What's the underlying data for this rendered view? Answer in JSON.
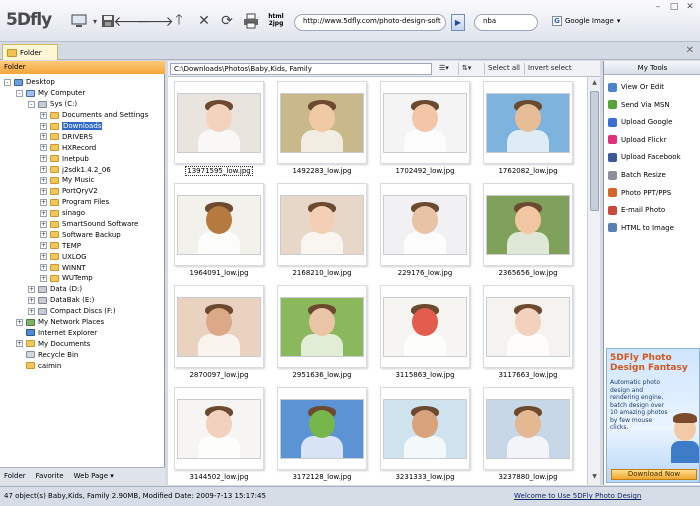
{
  "app": {
    "logo": "5Dfly"
  },
  "toolbar": {
    "html_label": "html 2jpg",
    "url": "http://www.5dfly.com/photo-design-soft",
    "search_text": "nba",
    "engine": "Google Image"
  },
  "tab": {
    "label": "Folder"
  },
  "left_panel": {
    "header": "Folder",
    "tree": [
      {
        "label": "Desktop",
        "level": 0,
        "exp": "-",
        "icon": "desk"
      },
      {
        "label": "My Computer",
        "level": 1,
        "exp": "-",
        "icon": "pc"
      },
      {
        "label": "Sys (C:)",
        "level": 2,
        "exp": "-",
        "icon": "drive"
      },
      {
        "label": "Documents and Settings",
        "level": 3,
        "exp": "+",
        "icon": "folder"
      },
      {
        "label": "Downloads",
        "level": 3,
        "exp": "+",
        "icon": "folder",
        "selected": true
      },
      {
        "label": "DRIVERS",
        "level": 3,
        "exp": "+",
        "icon": "folder"
      },
      {
        "label": "HXRecord",
        "level": 3,
        "exp": "+",
        "icon": "folder"
      },
      {
        "label": "Inetpub",
        "level": 3,
        "exp": "+",
        "icon": "folder"
      },
      {
        "label": "j2sdk1.4.2_06",
        "level": 3,
        "exp": "+",
        "icon": "folder"
      },
      {
        "label": "My Music",
        "level": 3,
        "exp": "+",
        "icon": "folder"
      },
      {
        "label": "PortQryV2",
        "level": 3,
        "exp": "+",
        "icon": "folder"
      },
      {
        "label": "Program Files",
        "level": 3,
        "exp": "+",
        "icon": "folder"
      },
      {
        "label": "sinago",
        "level": 3,
        "exp": "+",
        "icon": "folder"
      },
      {
        "label": "SmartSound Software",
        "level": 3,
        "exp": "+",
        "icon": "folder"
      },
      {
        "label": "Software Backup",
        "level": 3,
        "exp": "+",
        "icon": "folder"
      },
      {
        "label": "TEMP",
        "level": 3,
        "exp": "+",
        "icon": "folder"
      },
      {
        "label": "UXLOG",
        "level": 3,
        "exp": "+",
        "icon": "folder"
      },
      {
        "label": "WINNT",
        "level": 3,
        "exp": "+",
        "icon": "folder"
      },
      {
        "label": "WUTemp",
        "level": 3,
        "exp": "+",
        "icon": "folder"
      },
      {
        "label": "Data (D:)",
        "level": 2,
        "exp": "+",
        "icon": "drive"
      },
      {
        "label": "DataBak (E:)",
        "level": 2,
        "exp": "+",
        "icon": "drive"
      },
      {
        "label": "Compact Discs (F:)",
        "level": 2,
        "exp": "+",
        "icon": "drive"
      },
      {
        "label": "My Network Places",
        "level": 1,
        "exp": "+",
        "icon": "net"
      },
      {
        "label": "Internet Explorer",
        "level": 1,
        "exp": "",
        "icon": "ie"
      },
      {
        "label": "My Documents",
        "level": 1,
        "exp": "+",
        "icon": "folder"
      },
      {
        "label": "Recycle Bin",
        "level": 1,
        "exp": "",
        "icon": "bin"
      },
      {
        "label": "caimin",
        "level": 1,
        "exp": "",
        "icon": "folder"
      }
    ],
    "bottom_tabs": [
      "Folder",
      "Favorite",
      "Web Page ▾"
    ]
  },
  "center": {
    "path": "C:\\Downloads\\Photos\\Baby,Kids, Family",
    "sort_icon": "sort-icon",
    "select_all": "Select all",
    "invert_select": "Invert select",
    "thumbnails": [
      {
        "file": "13971595_low.jpg",
        "bg": "#e9e4de",
        "accent": "#f4d3bd",
        "selected": true
      },
      {
        "file": "1492283_low.jpg",
        "bg": "#c9b98a",
        "accent": "#f0c9a5"
      },
      {
        "file": "1702492_low.jpg",
        "bg": "#f4f4f4",
        "accent": "#f2c6a6"
      },
      {
        "file": "1762082_low.jpg",
        "bg": "#7db3dc",
        "accent": "#e7bd97"
      },
      {
        "file": "1964091_low.jpg",
        "bg": "#f3f1ec",
        "accent": "#b57a3f"
      },
      {
        "file": "2168210_low.jpg",
        "bg": "#e6d7c8",
        "accent": "#f2cfb5"
      },
      {
        "file": "229176_low.jpg",
        "bg": "#f1f1f3",
        "accent": "#e9c3a6"
      },
      {
        "file": "2365656_low.jpg",
        "bg": "#7fa15c",
        "accent": "#f0c7a2"
      },
      {
        "file": "2870097_low.jpg",
        "bg": "#e9d3c0",
        "accent": "#dba888"
      },
      {
        "file": "2951636_low.jpg",
        "bg": "#8cb85d",
        "accent": "#eac5a8"
      },
      {
        "file": "3115863_low.jpg",
        "bg": "#f7f5f2",
        "accent": "#e35c4e"
      },
      {
        "file": "3117663_low.jpg",
        "bg": "#f6f2ef",
        "accent": "#f3d1bd"
      },
      {
        "file": "3144502_low.jpg",
        "bg": "#f7f5f3",
        "accent": "#f2d2bf"
      },
      {
        "file": "3172128_low.jpg",
        "bg": "#5b93d4",
        "accent": "#77b64a"
      },
      {
        "file": "3231333_low.jpg",
        "bg": "#cfe3ee",
        "accent": "#d8a27c"
      },
      {
        "file": "3237880_low.jpg",
        "bg": "#c8d7e6",
        "accent": "#e4b893"
      }
    ]
  },
  "right_panel": {
    "header": "My Tools",
    "tools": [
      {
        "label": "View Or Edit",
        "icon": "view-icon",
        "color": "#4c84c9"
      },
      {
        "label": "Send Via MSN",
        "icon": "msn-icon",
        "color": "#57a23c"
      },
      {
        "label": "Upload Google",
        "icon": "google-icon",
        "color": "#3b6fd4"
      },
      {
        "label": "Upload Flickr",
        "icon": "flickr-icon",
        "color": "#e0307a"
      },
      {
        "label": "Upload Facebook",
        "icon": "facebook-icon",
        "color": "#3b5998"
      },
      {
        "label": "Batch Resize",
        "icon": "resize-icon",
        "color": "#8a8f98"
      },
      {
        "label": "Photo PPT/PPS",
        "icon": "ppt-icon",
        "color": "#d4652a"
      },
      {
        "label": "E-mail Photo",
        "icon": "email-icon",
        "color": "#c94a3c"
      },
      {
        "label": "HTML to Image",
        "icon": "html-icon",
        "color": "#5a7fb5"
      }
    ],
    "ad": {
      "title": "5DFly Photo Design Fantasy",
      "text": "Automatic photo design and rendering engine, batch design over 10 amazing photos by few mouse clicks.",
      "button": "Download Now"
    }
  },
  "status": {
    "text": "47 object(s) Baby,Kids, Family  2.90MB, Modified Date: 2009-7-13 15:17:45",
    "link": "Welcome to Use 5DFly Photo Design"
  }
}
